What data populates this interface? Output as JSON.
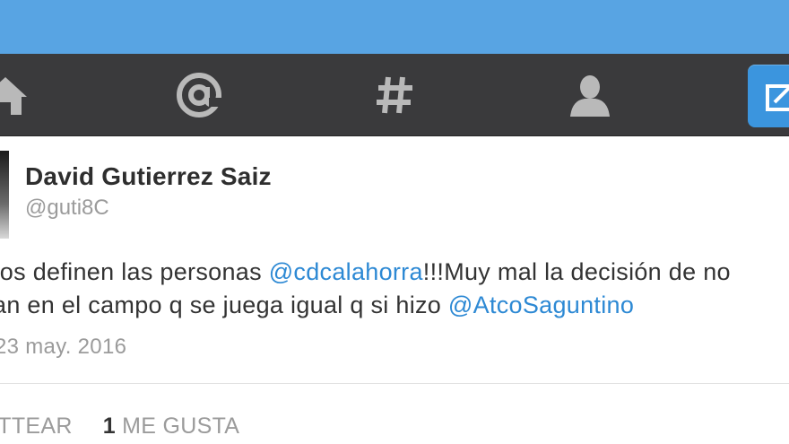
{
  "nav": {
    "icons": [
      "home-icon",
      "mentions-icon",
      "hashtag-icon",
      "profile-icon",
      "compose-icon"
    ]
  },
  "tweet": {
    "author_name": "David Gutierrez Saiz",
    "author_handle": "@guti8C",
    "line1_text": "tos definen las personas ",
    "line1_mention": "@cdcalahorra",
    "line1_rest": "!!!Muy mal la decisión de no",
    "line2_text": "an en el campo q se juega igual q si hizo ",
    "line2_mention": "@AtcoSaguntino",
    "date": "23 may. 2016",
    "retweet_label": "ITTEAR",
    "like_count": "1",
    "like_label": "ME GUSTA"
  },
  "colors": {
    "top_bar": "#58a4e3",
    "nav_bar": "#3a3a3c",
    "mention": "#2d89d4",
    "compose_button": "#3b95de"
  }
}
